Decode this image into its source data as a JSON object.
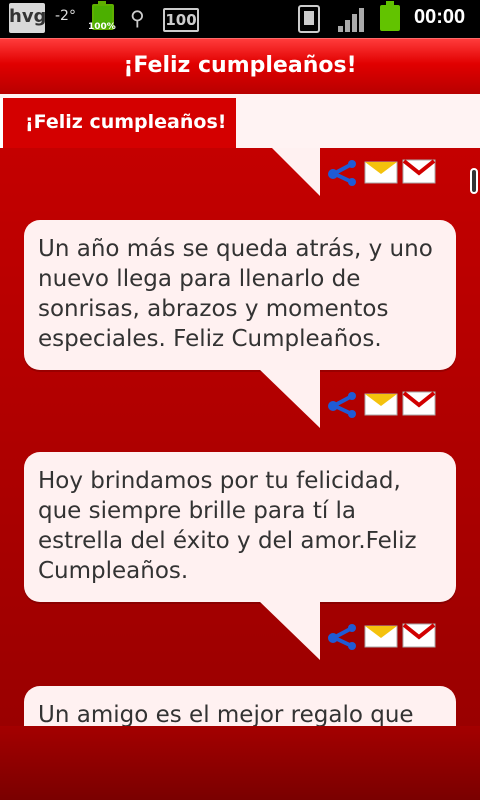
{
  "status_bar": {
    "carrier_logo": "hvg",
    "temperature": "-2°",
    "battery_small_percent": "100%",
    "usb_icon": "usb-icon",
    "badge": "100",
    "time": "00:00"
  },
  "app": {
    "title": "¡Feliz cumpleaños!"
  },
  "tab": {
    "label": "¡Feliz cumpleaños!"
  },
  "messages": [
    {
      "text": "Un año más se queda atrás, y uno nuevo llega para llenarlo de sonrisas, abrazos y momentos especiales. Feliz Cumpleaños."
    },
    {
      "text": "Hoy brindamos por tu felicidad, que siempre brille para tí la estrella del éxito y del amor.Feliz Cumpleaños."
    },
    {
      "text": "Un amigo es el mejor regalo que se"
    }
  ],
  "colors": {
    "accent": "#d40000",
    "bubble": "#fff1f1",
    "background": "#9a0000"
  },
  "icons": [
    "share-icon",
    "sms-icon",
    "gmail-icon"
  ]
}
